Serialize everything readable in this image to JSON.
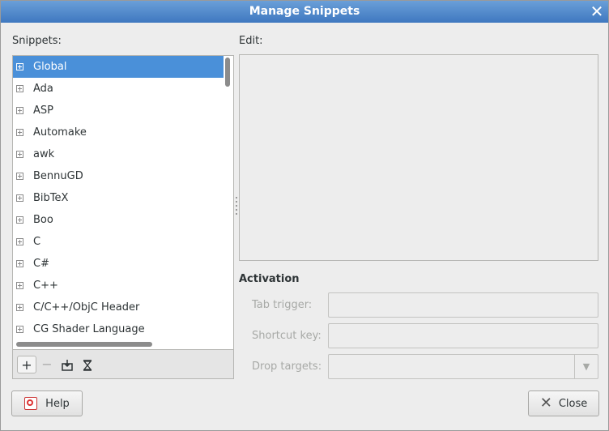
{
  "window": {
    "title": "Manage Snippets"
  },
  "snippets": {
    "label": "Snippets:",
    "items": [
      {
        "label": "Global",
        "selected": true
      },
      {
        "label": "Ada"
      },
      {
        "label": "ASP"
      },
      {
        "label": "Automake"
      },
      {
        "label": "awk"
      },
      {
        "label": "BennuGD"
      },
      {
        "label": "BibTeX"
      },
      {
        "label": "Boo"
      },
      {
        "label": "C"
      },
      {
        "label": "C#"
      },
      {
        "label": "C++"
      },
      {
        "label": "C/C++/ObjC Header"
      },
      {
        "label": "CG Shader Language"
      }
    ],
    "toolbar": {
      "add": "+",
      "remove": "−",
      "import": "import-icon",
      "export": "export-icon"
    }
  },
  "edit": {
    "label": "Edit:"
  },
  "activation": {
    "title": "Activation",
    "tab_trigger_label": "Tab trigger:",
    "shortcut_key_label": "Shortcut key:",
    "drop_targets_label": "Drop targets:"
  },
  "buttons": {
    "help": "Help",
    "close": "Close"
  },
  "colors": {
    "accent": "#4a90d9",
    "titlebar": "#3f78c0"
  }
}
